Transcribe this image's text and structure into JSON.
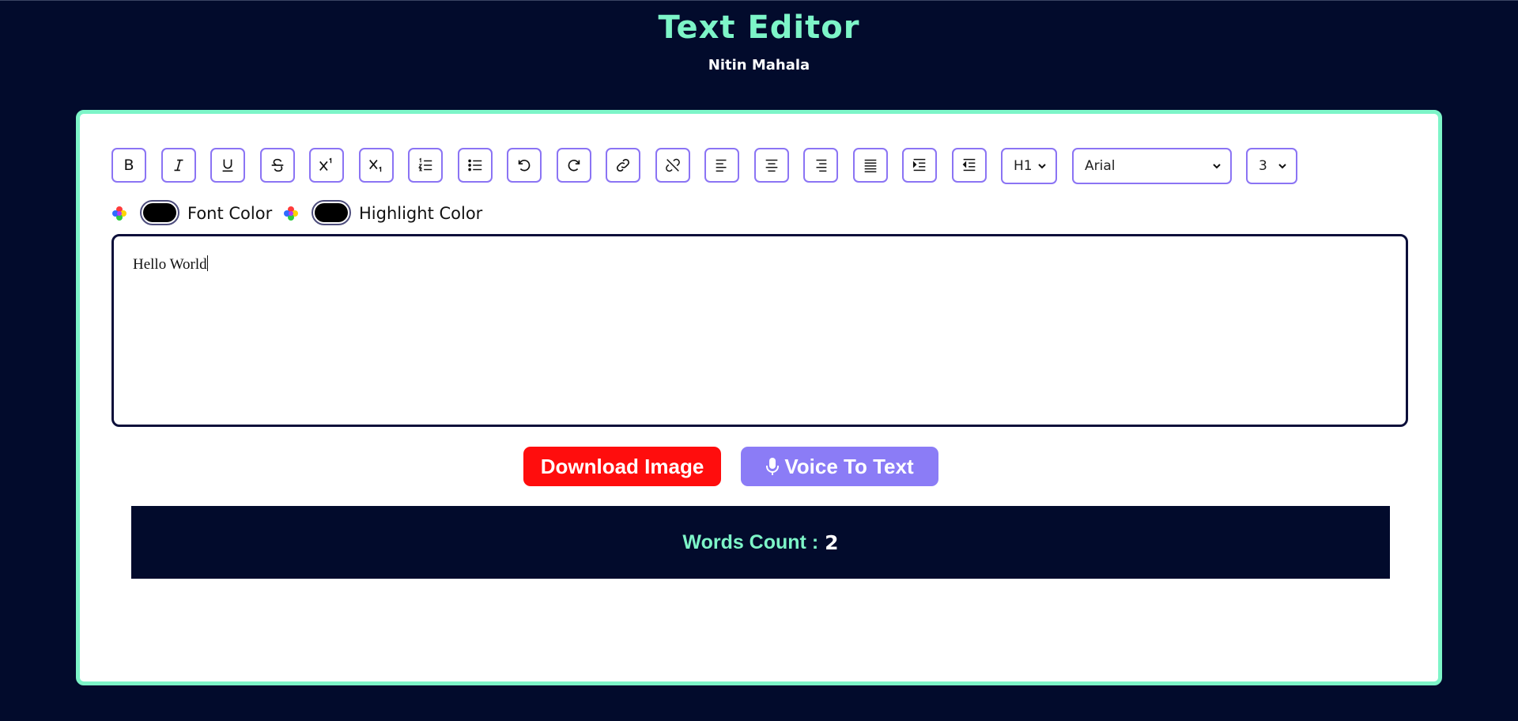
{
  "header": {
    "title": "Text Editor",
    "author": "Nitin Mahala"
  },
  "toolbar": {
    "buttons": [
      {
        "name": "bold-button",
        "icon": "bold-icon",
        "glyph": "B"
      },
      {
        "name": "italic-button",
        "icon": "italic-icon"
      },
      {
        "name": "underline-button",
        "icon": "underline-icon"
      },
      {
        "name": "strikethrough-button",
        "icon": "strikethrough-icon"
      },
      {
        "name": "superscript-button",
        "icon": "superscript-icon"
      },
      {
        "name": "subscript-button",
        "icon": "subscript-icon"
      },
      {
        "name": "ordered-list-button",
        "icon": "ordered-list-icon"
      },
      {
        "name": "unordered-list-button",
        "icon": "unordered-list-icon"
      },
      {
        "name": "undo-button",
        "icon": "undo-icon"
      },
      {
        "name": "redo-button",
        "icon": "redo-icon"
      },
      {
        "name": "link-button",
        "icon": "link-icon"
      },
      {
        "name": "unlink-button",
        "icon": "unlink-icon"
      },
      {
        "name": "align-left-button",
        "icon": "align-left-icon"
      },
      {
        "name": "align-center-button",
        "icon": "align-center-icon"
      },
      {
        "name": "align-right-button",
        "icon": "align-right-icon"
      },
      {
        "name": "align-justify-button",
        "icon": "align-justify-icon"
      },
      {
        "name": "indent-button",
        "icon": "indent-icon"
      },
      {
        "name": "outdent-button",
        "icon": "outdent-icon"
      }
    ],
    "heading_select": "H1",
    "font_select": "Arial",
    "size_select": "3"
  },
  "colors": {
    "font_color_label": "Font Color",
    "highlight_color_label": "Highlight Color",
    "font_color_value": "#000000",
    "highlight_color_value": "#000000"
  },
  "editor": {
    "content": "Hello World"
  },
  "actions": {
    "download_label": "Download Image",
    "voice_label": "Voice To Text"
  },
  "word_count": {
    "label": "Words Count :",
    "value": "2"
  },
  "theme": {
    "background": "#020b2c",
    "accent": "#7df5c8",
    "button_border": "#8b74f4",
    "download_color": "#ff0d0d",
    "voice_color": "#8b7cf6"
  }
}
